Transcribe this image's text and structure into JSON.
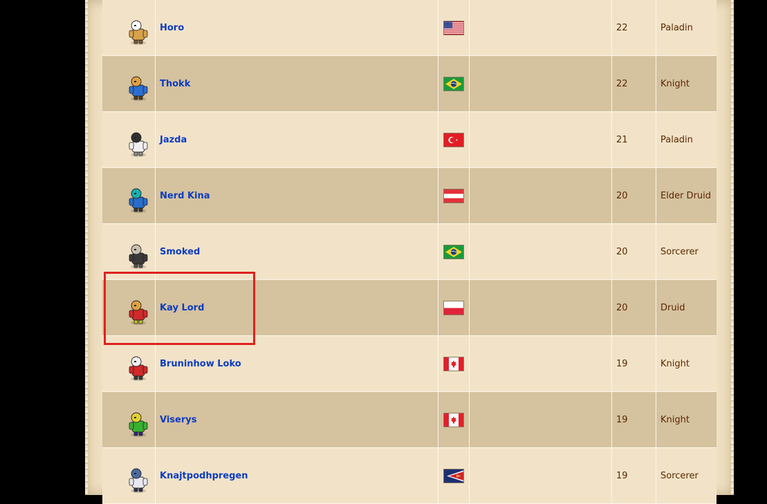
{
  "highscores": {
    "rows": [
      {
        "name": "Horo",
        "country": "United States",
        "flag_icon": "us-flag-icon",
        "level": "22",
        "vocation": "Paladin",
        "outfit_colors": [
          "#d9a24a",
          "#ffffff",
          "#8a5a2a"
        ]
      },
      {
        "name": "Thokk",
        "country": "Brazil",
        "flag_icon": "brazil-flag-icon",
        "level": "22",
        "vocation": "Knight",
        "outfit_colors": [
          "#2c6fd1",
          "#e0a040",
          "#5a3a1a"
        ]
      },
      {
        "name": "Jazda",
        "country": "Turkey",
        "flag_icon": "turkey-flag-icon",
        "level": "21",
        "vocation": "Paladin",
        "outfit_colors": [
          "#f0f0f0",
          "#303030",
          "#909090"
        ]
      },
      {
        "name": "Nerd Kina",
        "country": "Austria",
        "flag_icon": "austria-flag-icon",
        "level": "20",
        "vocation": "Elder Druid",
        "outfit_colors": [
          "#2a6cc8",
          "#18b0b0",
          "#3a3a3a"
        ]
      },
      {
        "name": "Smoked",
        "country": "Brazil",
        "flag_icon": "brazil-flag-icon",
        "level": "20",
        "vocation": "Sorcerer",
        "outfit_colors": [
          "#3a3a3a",
          "#c8c0b0",
          "#555555"
        ]
      },
      {
        "name": "Kay Lord",
        "country": "Poland",
        "flag_icon": "poland-flag-icon",
        "level": "20",
        "vocation": "Druid",
        "outfit_colors": [
          "#d02a2a",
          "#e0a040",
          "#c8c820"
        ]
      },
      {
        "name": "Bruninhow Loko",
        "country": "Canada",
        "flag_icon": "canada-flag-icon",
        "level": "19",
        "vocation": "Knight",
        "outfit_colors": [
          "#d02a2a",
          "#f0f0f0",
          "#3a3a3a"
        ]
      },
      {
        "name": "Viserys",
        "country": "Canada",
        "flag_icon": "canada-flag-icon",
        "level": "19",
        "vocation": "Knight",
        "outfit_colors": [
          "#3ab030",
          "#e0d030",
          "#2a2a8a"
        ]
      },
      {
        "name": "Knajtpodhpregen",
        "country": "American Samoa",
        "flag_icon": "american-samoa-flag-icon",
        "level": "19",
        "vocation": "Sorcerer",
        "outfit_colors": [
          "#e8e8f0",
          "#4a6aa0",
          "#303050"
        ]
      }
    ],
    "highlighted_row": "Kay Lord",
    "colors": {
      "row_light": "#f2e3c8",
      "row_dark": "#d5c29f",
      "link": "#0b3cc1",
      "text": "#5a2800",
      "highlight": "#e02020"
    }
  }
}
